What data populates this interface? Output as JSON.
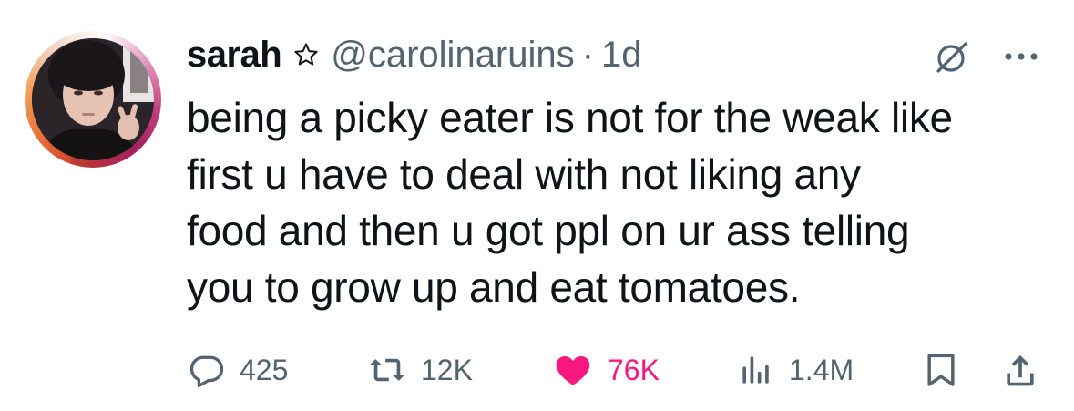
{
  "author": {
    "display_name": "sarah",
    "handle": "@carolinaruins",
    "separator": "·",
    "time": "1d"
  },
  "icons": {
    "star": "star-icon",
    "edit": "edit-slash-icon",
    "more": "more-dots-icon"
  },
  "tweet": {
    "text": "being a picky eater is not for the weak like\nfirst u have to deal with not liking any\nfood and then u got ppl on ur ass telling\nyou to grow up and eat tomatoes."
  },
  "actions": {
    "replies": "425",
    "retweets": "12K",
    "likes": "76K",
    "views": "1.4M"
  },
  "colors": {
    "text": "#0f1419",
    "secondary": "#536471",
    "like": "#f91880"
  }
}
